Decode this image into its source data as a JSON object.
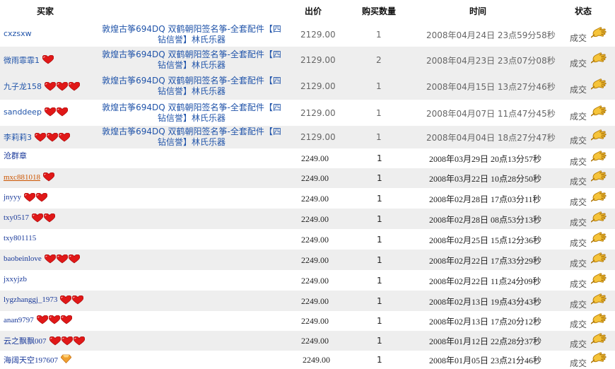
{
  "headers": {
    "buyer": "买家",
    "price": "出价",
    "qty": "购买数量",
    "time": "时间",
    "status": "状态"
  },
  "rows": [
    {
      "buyer": "cxzsxw",
      "hearts": 0,
      "item": "敦煌古筝694DQ 双鹤朝阳签名筝-全套配件【四钻信誉】林氏乐器",
      "price": "2129.00",
      "qty": "1",
      "time": "2008年04月24日  23点59分58秒",
      "status": "成交"
    },
    {
      "buyer": "微雨霏霏1",
      "hearts": 1,
      "item": "敦煌古筝694DQ 双鹤朝阳签名筝-全套配件【四钻信誉】林氏乐器",
      "price": "2129.00",
      "qty": "2",
      "time": "2008年04月23日  23点07分08秒",
      "status": "成交"
    },
    {
      "buyer": "九子龙158",
      "hearts": 3,
      "item": "敦煌古筝694DQ 双鹤朝阳签名筝-全套配件【四钻信誉】林氏乐器",
      "price": "2129.00",
      "qty": "1",
      "time": "2008年04月15日  13点27分46秒",
      "status": "成交"
    },
    {
      "buyer": "sanddeep",
      "hearts": 2,
      "item": "敦煌古筝694DQ 双鹤朝阳签名筝-全套配件【四钻信誉】林氏乐器",
      "price": "2129.00",
      "qty": "1",
      "time": "2008年04月07日  11点47分45秒",
      "status": "成交"
    },
    {
      "buyer": "李莉莉3",
      "hearts": 3,
      "item": "敦煌古筝694DQ 双鹤朝阳签名筝-全套配件【四钻信誉】林氏乐器",
      "price": "2129.00",
      "qty": "1",
      "time": "2008年04月04日  18点27分47秒",
      "status": "成交"
    },
    {
      "buyer": "沧群章",
      "hearts": 0,
      "price": "2249.00",
      "qty": "1",
      "time": "2008年03月29日  20点13分57秒",
      "status": "成交"
    },
    {
      "buyer": "mxc881018",
      "hearts": 1,
      "price": "2249.00",
      "qty": "1",
      "time": "2008年03月22日  10点28分50秒",
      "status": "成交"
    },
    {
      "buyer": "jnyyy",
      "hearts": 2,
      "price": "2249.00",
      "qty": "1",
      "time": "2008年02月28日  17点03分11秒",
      "status": "成交"
    },
    {
      "buyer": "txy0517",
      "hearts": 2,
      "price": "2249.00",
      "qty": "1",
      "time": "2008年02月28日  08点53分13秒",
      "status": "成交"
    },
    {
      "buyer": "txy801115",
      "hearts": 0,
      "price": "2249.00",
      "qty": "1",
      "time": "2008年02月25日  15点12分36秒",
      "status": "成交"
    },
    {
      "buyer": "baobeinlove",
      "hearts": 3,
      "price": "2249.00",
      "qty": "1",
      "time": "2008年02月22日  17点33分29秒",
      "status": "成交"
    },
    {
      "buyer": "jxxyjzb",
      "hearts": 0,
      "price": "2249.00",
      "qty": "1",
      "time": "2008年02月22日  11点24分09秒",
      "status": "成交"
    },
    {
      "buyer": "lygzhanggj_1973",
      "hearts": 2,
      "price": "2249.00",
      "qty": "1",
      "time": "2008年02月13日  19点43分43秒",
      "status": "成交"
    },
    {
      "buyer": "anan9797",
      "hearts": 3,
      "price": "2249.00",
      "qty": "1",
      "time": "2008年02月13日  17点20分12秒",
      "status": "成交"
    },
    {
      "buyer": "云之飘飘007",
      "hearts": 3,
      "price": "2249.00",
      "qty": "1",
      "time": "2008年01月12日  22点28分37秒",
      "status": "成交"
    },
    {
      "buyer": "海阔天空197607",
      "hearts": 0,
      "diamond": true,
      "price": "2249.00",
      "qty": "1",
      "time": "2008年01月05日  23点21分46秒",
      "status": "成交"
    }
  ]
}
